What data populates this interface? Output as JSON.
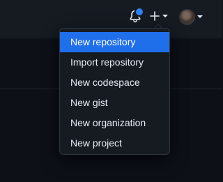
{
  "header": {
    "notifications_icon": "bell-icon",
    "create_icon": "plus-icon",
    "profile_icon": "avatar"
  },
  "create_menu": {
    "items": [
      {
        "label": "New repository",
        "active": true
      },
      {
        "label": "Import repository",
        "active": false
      },
      {
        "label": "New codespace",
        "active": false
      },
      {
        "label": "New gist",
        "active": false
      },
      {
        "label": "New organization",
        "active": false
      },
      {
        "label": "New project",
        "active": false
      }
    ]
  },
  "colors": {
    "background": "#0d1117",
    "header": "#161b22",
    "menu_bg": "#161b22",
    "highlight": "#1f6feb",
    "notification_dot": "#2f81f7",
    "text": "#e6edf3"
  }
}
